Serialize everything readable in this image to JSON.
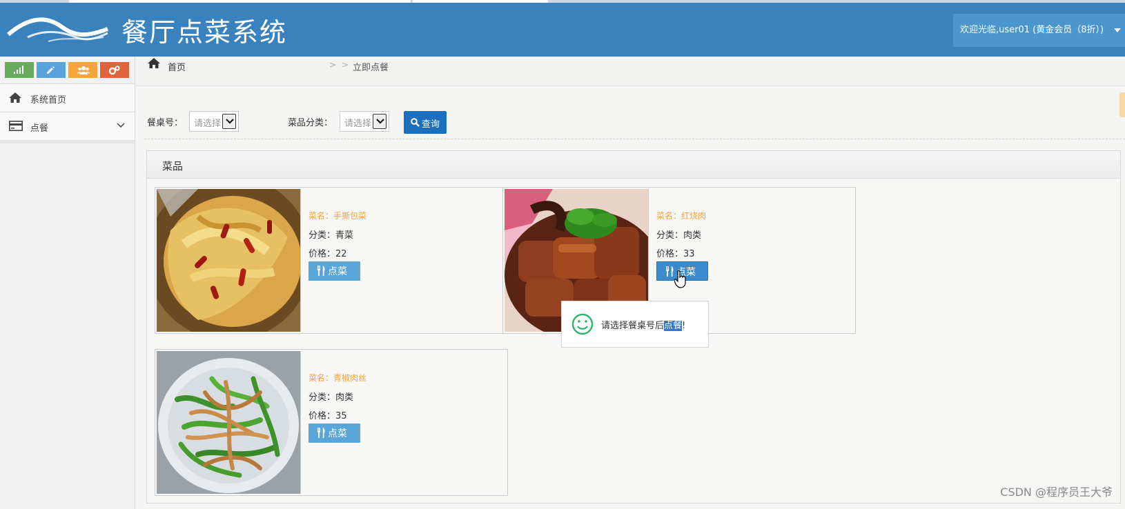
{
  "header": {
    "title": "餐厅点菜系统",
    "user_info": "欢迎光临,user01 (黄金会员（8折）)"
  },
  "sidebar": {
    "shortcut_colors": [
      "#6aaa5c",
      "#58a3dc",
      "#f5a53a",
      "#e0643b"
    ],
    "items": [
      {
        "label": "系统首页",
        "icon": "home-icon"
      },
      {
        "label": "点餐",
        "icon": "card-icon"
      }
    ]
  },
  "breadcrumb": {
    "home": "首页",
    "sep1": ">",
    "sep2": ">",
    "current": "立即点餐"
  },
  "filter": {
    "table_label": "餐桌号：",
    "table_placeholder": "请选择",
    "category_label": "菜品分类：",
    "category_placeholder": "请选择",
    "query_label": "查询"
  },
  "panel": {
    "title": "菜品",
    "dishes": [
      {
        "name": "菜名：手撕包菜",
        "category": "分类：青菜",
        "price": "价格：22",
        "button": "点菜"
      },
      {
        "name": "菜名：红烧肉",
        "category": "分类：肉类",
        "price": "价格：33",
        "button": "点菜"
      },
      {
        "name": "菜名：青椒肉丝",
        "category": "分类：肉类",
        "price": "价格：35",
        "button": "点菜"
      }
    ]
  },
  "toast": {
    "message_prefix": "请选择餐桌号后",
    "message_highlight": "点餐",
    "message_suffix": "!"
  },
  "watermark": "CSDN @程序员王大爷"
}
